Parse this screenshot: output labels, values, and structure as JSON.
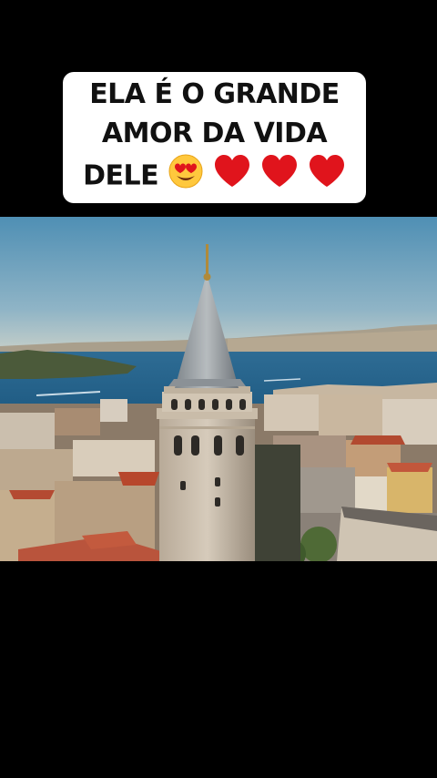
{
  "caption": {
    "line1": "ELA É O GRANDE",
    "line2": "AMOR DA VIDA",
    "line3_text": "DELE",
    "emojis": [
      "smiling-face-with-heart-eyes",
      "red-heart",
      "red-heart",
      "red-heart"
    ]
  },
  "video": {
    "subject": "aerial view of a stone tower with conical roof over a city by the water"
  },
  "colors": {
    "background": "#000000",
    "caption_bg": "#ffffff",
    "caption_text": "#111111",
    "heart": "#e0141c"
  }
}
